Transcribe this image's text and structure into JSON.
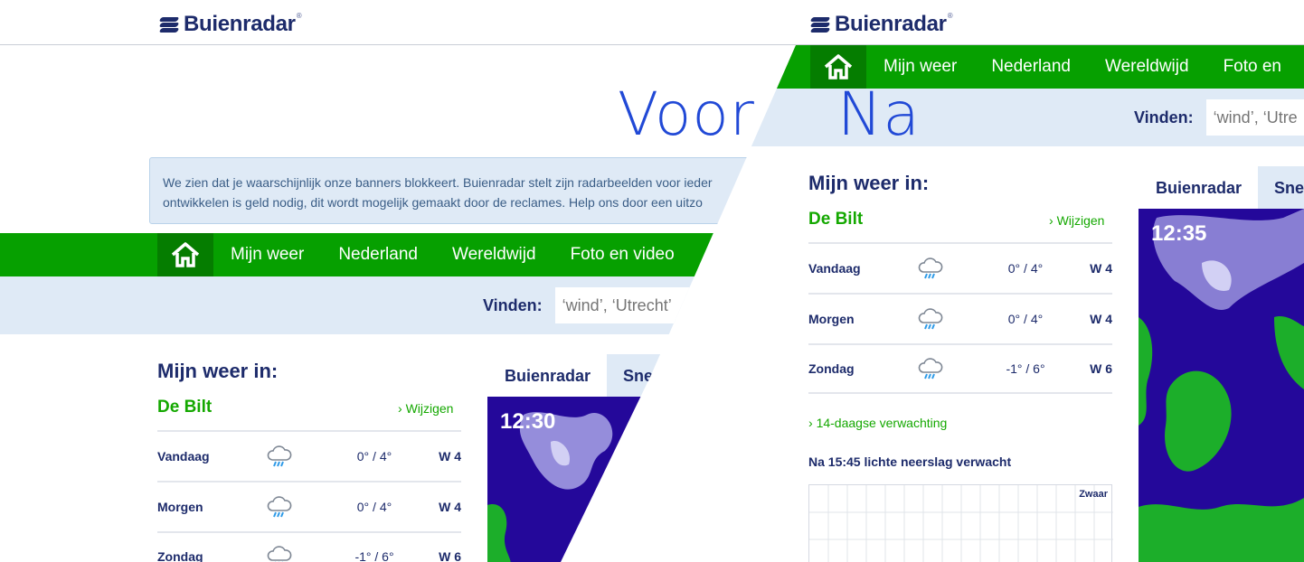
{
  "brand": {
    "name": "Buienradar",
    "mark": "®"
  },
  "labels": {
    "before": "Voor",
    "after": "Na"
  },
  "notice": {
    "line1": "We zien dat je waarschijnlijk onze banners blokkeert. Buienradar stelt zijn radarbeelden voor ieder",
    "line2": "ontwikkelen is geld nodig, dit wordt mogelijk gemaakt door de reclames. Help ons door een uitzo"
  },
  "nav": {
    "home_icon": "home-icon",
    "items": [
      "Mijn weer",
      "Nederland",
      "Wereldwijd",
      "Foto en video"
    ],
    "items_right": [
      "Mijn weer",
      "Nederland",
      "Wereldwijd",
      "Foto en"
    ]
  },
  "search": {
    "label": "Vinden:",
    "placeholder_left": "‘wind’, ‘Utrecht’",
    "placeholder_right": "‘wind’, ‘Utre"
  },
  "myweather": {
    "title": "Mijn weer in:",
    "city": "De Bilt",
    "change": "Wijzigen",
    "rows": [
      {
        "day": "Vandaag",
        "temp": "0° / 4°",
        "wind": "W 4",
        "icon": "rain-cloud-icon"
      },
      {
        "day": "Morgen",
        "temp": "0° / 4°",
        "wind": "W 4",
        "icon": "rain-cloud-icon"
      },
      {
        "day": "Zondag",
        "temp": "-1° / 6°",
        "wind": "W 6",
        "icon": "rain-cloud-icon"
      }
    ],
    "forecast_link": "14-daagse verwachting",
    "rain_note": "Na 15:45 lichte neerslag verwacht",
    "rain_chart_tag": "Zwaar"
  },
  "tabs": {
    "left": [
      "Buienradar",
      "Sne"
    ],
    "right": [
      "Buienradar",
      "Sne"
    ]
  },
  "radar": {
    "time_left": "12:30",
    "time_right": "12:35"
  },
  "colors": {
    "green": "#06a000",
    "dark_green": "#057d00",
    "navy": "#1d2b6b",
    "radar_bg": "#24089a",
    "land": "#1cae2a",
    "light_blue": "#dfeaf6"
  }
}
